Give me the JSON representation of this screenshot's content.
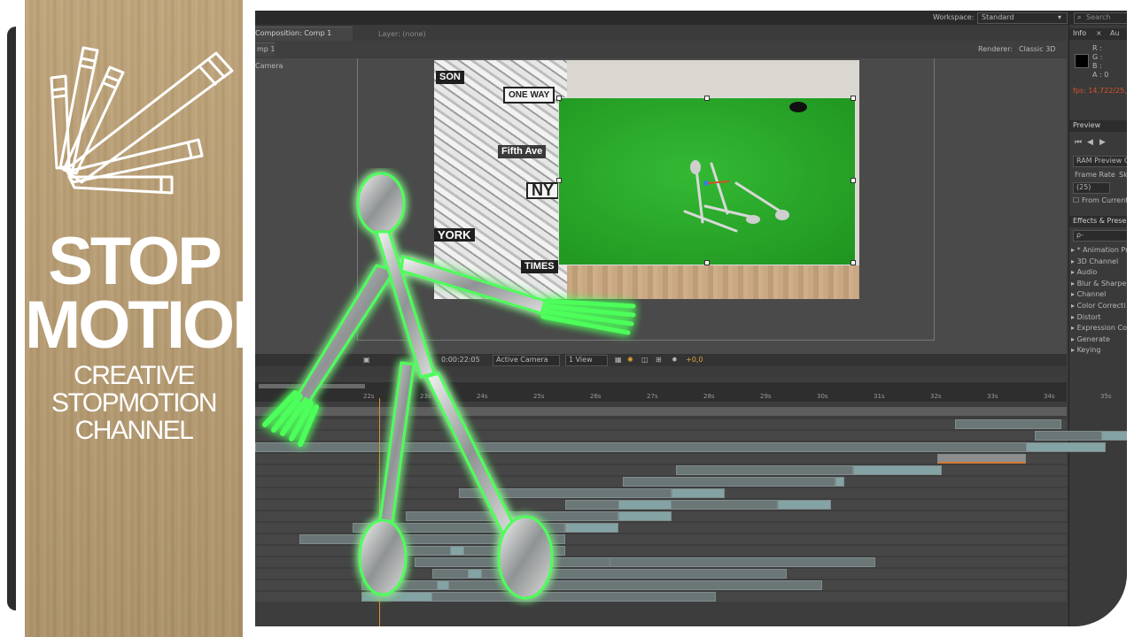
{
  "banner": {
    "title_line1": "STOP",
    "title_line2": "MOTION",
    "subtitle_line1": "CREATIVE",
    "subtitle_line2": "STOPMOTION",
    "subtitle_line3": "CHANNEL",
    "logo_icon": "pencils-fan-icon"
  },
  "app": {
    "workspace_label": "Workspace:",
    "workspace_value": "Standard",
    "search_placeholder": "Search",
    "composition_tab": "Composition: Comp 1",
    "layer_tab": "Layer: (none)",
    "comp_subtab": "mp 1",
    "renderer_label": "Renderer:",
    "renderer_value": "Classic 3D",
    "camera_label": "Camera",
    "timecode": "0:00:22:05",
    "view_camera": "Active Camera",
    "view_count": "1 View",
    "exposure": "+0,0",
    "info_tab": "Info",
    "info_tab2": "Au",
    "info_r": "R :",
    "info_g": "G :",
    "info_b": "B :",
    "info_a": "A : 0",
    "fps_text": "fps: 14,722/25,0",
    "preview_tab": "Preview",
    "ram_preview": "RAM Preview O",
    "frame_rate_label": "Frame Rate",
    "frame_rate_short": "Sk",
    "frame_rate_value": "(25)",
    "from_current": "From Current",
    "effects_tab": "Effects & Prese",
    "effects_search": "ρ-",
    "effects_items": [
      "* Animation Pr",
      "3D Channel",
      "Audio",
      "Blur & Sharpen",
      "Channel",
      "Color Correcti",
      "Distort",
      "Expression Co",
      "Generate",
      "Keying"
    ],
    "ruler_ticks": [
      "22s",
      "23s",
      "24s",
      "25s",
      "26s",
      "27s",
      "28s",
      "29s",
      "30s",
      "31s",
      "32s",
      "33s",
      "34s",
      "35s"
    ]
  },
  "photo": {
    "stickers": [
      "SON",
      "ONE WAY",
      "Fifth Ave",
      "NY",
      "YORK",
      "TIMES"
    ]
  },
  "colors": {
    "greenscreen": "#2aa82a",
    "fps_color": "#d9532c",
    "playhead": "#e0902a",
    "glow": "#3dff4a"
  }
}
